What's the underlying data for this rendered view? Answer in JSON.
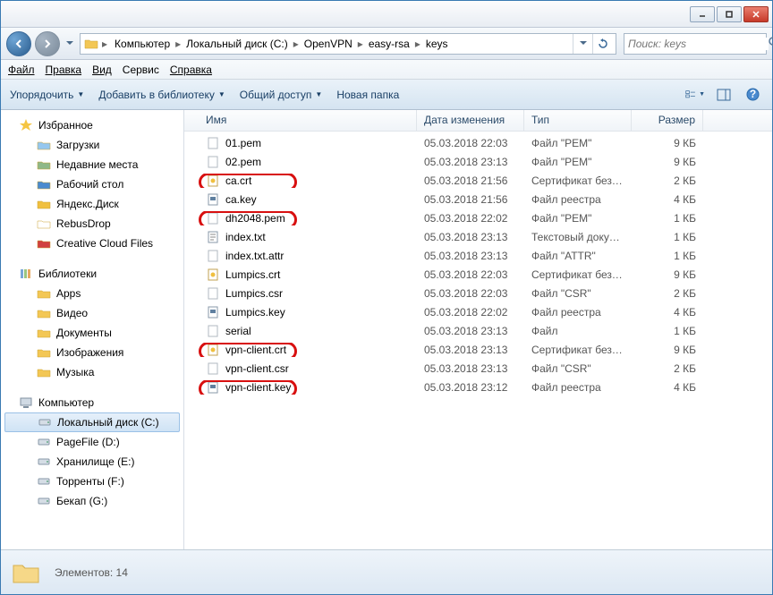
{
  "titlebar": {
    "min": "_",
    "max": "◻",
    "close": "✕"
  },
  "nav": {
    "crumbs": [
      "Компьютер",
      "Локальный диск (C:)",
      "OpenVPN",
      "easy-rsa",
      "keys"
    ],
    "search_placeholder": "Поиск: keys"
  },
  "menu": {
    "file": "Файл",
    "edit": "Правка",
    "view": "Вид",
    "service": "Сервис",
    "help": "Справка"
  },
  "toolbar": {
    "organize": "Упорядочить",
    "addlib": "Добавить в библиотеку",
    "share": "Общий доступ",
    "newfolder": "Новая папка"
  },
  "sidebar": {
    "favorites": {
      "label": "Избранное",
      "items": [
        "Загрузки",
        "Недавние места",
        "Рабочий стол",
        "Яндекс.Диск",
        "RebusDrop",
        "Creative Cloud Files"
      ]
    },
    "libraries": {
      "label": "Библиотеки",
      "items": [
        "Apps",
        "Видео",
        "Документы",
        "Изображения",
        "Музыка"
      ]
    },
    "computer": {
      "label": "Компьютер",
      "items": [
        "Локальный диск (C:)",
        "PageFile (D:)",
        "Хранилище (E:)",
        "Торренты (F:)",
        "Бекап (G:)"
      ]
    }
  },
  "columns": {
    "name": "Имя",
    "date": "Дата изменения",
    "type": "Тип",
    "size": "Размер"
  },
  "files": [
    {
      "name": "01.pem",
      "date": "05.03.2018 22:03",
      "type": "Файл \"PEM\"",
      "size": "9 КБ",
      "icon": "doc",
      "hl": false
    },
    {
      "name": "02.pem",
      "date": "05.03.2018 23:13",
      "type": "Файл \"PEM\"",
      "size": "9 КБ",
      "icon": "doc",
      "hl": false
    },
    {
      "name": "ca.crt",
      "date": "05.03.2018 21:56",
      "type": "Сертификат безо…",
      "size": "2 КБ",
      "icon": "cert",
      "hl": true
    },
    {
      "name": "ca.key",
      "date": "05.03.2018 21:56",
      "type": "Файл реестра",
      "size": "4 КБ",
      "icon": "key",
      "hl": false
    },
    {
      "name": "dh2048.pem",
      "date": "05.03.2018 22:02",
      "type": "Файл \"PEM\"",
      "size": "1 КБ",
      "icon": "doc",
      "hl": true
    },
    {
      "name": "index.txt",
      "date": "05.03.2018 23:13",
      "type": "Текстовый докум…",
      "size": "1 КБ",
      "icon": "txt",
      "hl": false
    },
    {
      "name": "index.txt.attr",
      "date": "05.03.2018 23:13",
      "type": "Файл \"ATTR\"",
      "size": "1 КБ",
      "icon": "doc",
      "hl": false
    },
    {
      "name": "Lumpics.crt",
      "date": "05.03.2018 22:03",
      "type": "Сертификат безо…",
      "size": "9 КБ",
      "icon": "cert",
      "hl": false
    },
    {
      "name": "Lumpics.csr",
      "date": "05.03.2018 22:03",
      "type": "Файл \"CSR\"",
      "size": "2 КБ",
      "icon": "doc",
      "hl": false
    },
    {
      "name": "Lumpics.key",
      "date": "05.03.2018 22:02",
      "type": "Файл реестра",
      "size": "4 КБ",
      "icon": "key",
      "hl": false
    },
    {
      "name": "serial",
      "date": "05.03.2018 23:13",
      "type": "Файл",
      "size": "1 КБ",
      "icon": "doc",
      "hl": false
    },
    {
      "name": "vpn-client.crt",
      "date": "05.03.2018 23:13",
      "type": "Сертификат безо…",
      "size": "9 КБ",
      "icon": "cert",
      "hl": true
    },
    {
      "name": "vpn-client.csr",
      "date": "05.03.2018 23:13",
      "type": "Файл \"CSR\"",
      "size": "2 КБ",
      "icon": "doc",
      "hl": false
    },
    {
      "name": "vpn-client.key",
      "date": "05.03.2018 23:12",
      "type": "Файл реестра",
      "size": "4 КБ",
      "icon": "key",
      "hl": true
    }
  ],
  "status": {
    "text": "Элементов: 14"
  }
}
